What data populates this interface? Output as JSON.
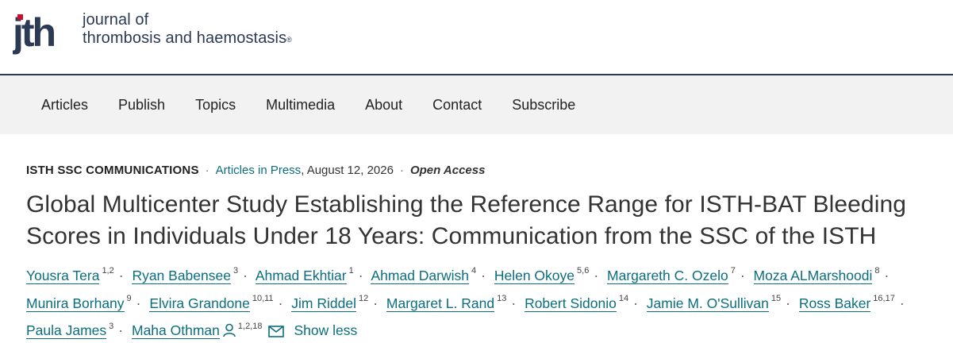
{
  "header": {
    "logo_text": "jth",
    "journal_line1": "journal of",
    "journal_line2": "thrombosis and haemostasis",
    "registered_mark": "®"
  },
  "nav": {
    "items": [
      "Articles",
      "Publish",
      "Topics",
      "Multimedia",
      "About",
      "Contact",
      "Subscribe"
    ]
  },
  "article": {
    "section": "ISTH SSC COMMUNICATIONS",
    "separator": "·",
    "status": "Articles in Press",
    "date": ", August 12, 2026",
    "access": "Open Access",
    "title_line1": "Global Multicenter Study Establishing the Reference Range for ISTH-BAT Bleeding",
    "title_line2": "Scores in Individuals Under 18 Years: Communication from the SSC of the ISTH",
    "authors": [
      {
        "name": "Yousra Tera",
        "aff": "1,2"
      },
      {
        "name": "Ryan Babensee",
        "aff": "3"
      },
      {
        "name": "Ahmad Ekhtiar",
        "aff": "1"
      },
      {
        "name": "Ahmad Darwish",
        "aff": "4"
      },
      {
        "name": "Helen Okoye",
        "aff": "5,6"
      },
      {
        "name": "Margareth C. Ozelo",
        "aff": "7"
      },
      {
        "name": "Moza ALMarshoodi",
        "aff": "8"
      },
      {
        "name": "Munira Borhany",
        "aff": "9"
      },
      {
        "name": "Elvira Grandone",
        "aff": "10,11"
      },
      {
        "name": "Jim Riddel",
        "aff": "12"
      },
      {
        "name": "Margaret L. Rand",
        "aff": "13"
      },
      {
        "name": "Robert Sidonio",
        "aff": "14"
      },
      {
        "name": "Jamie M. O'Sullivan",
        "aff": "15"
      },
      {
        "name": "Ross Baker",
        "aff": "16,17"
      },
      {
        "name": "Paula James",
        "aff": "3"
      },
      {
        "name": "Maha Othman",
        "aff": "1,2,18"
      }
    ],
    "show_less": "Show less"
  },
  "colors": {
    "brand_navy": "#2b3a55",
    "link_teal": "#0a6e7e",
    "nav_bg": "#f2f2f2"
  },
  "icons": [
    "person-icon",
    "mail-icon"
  ]
}
